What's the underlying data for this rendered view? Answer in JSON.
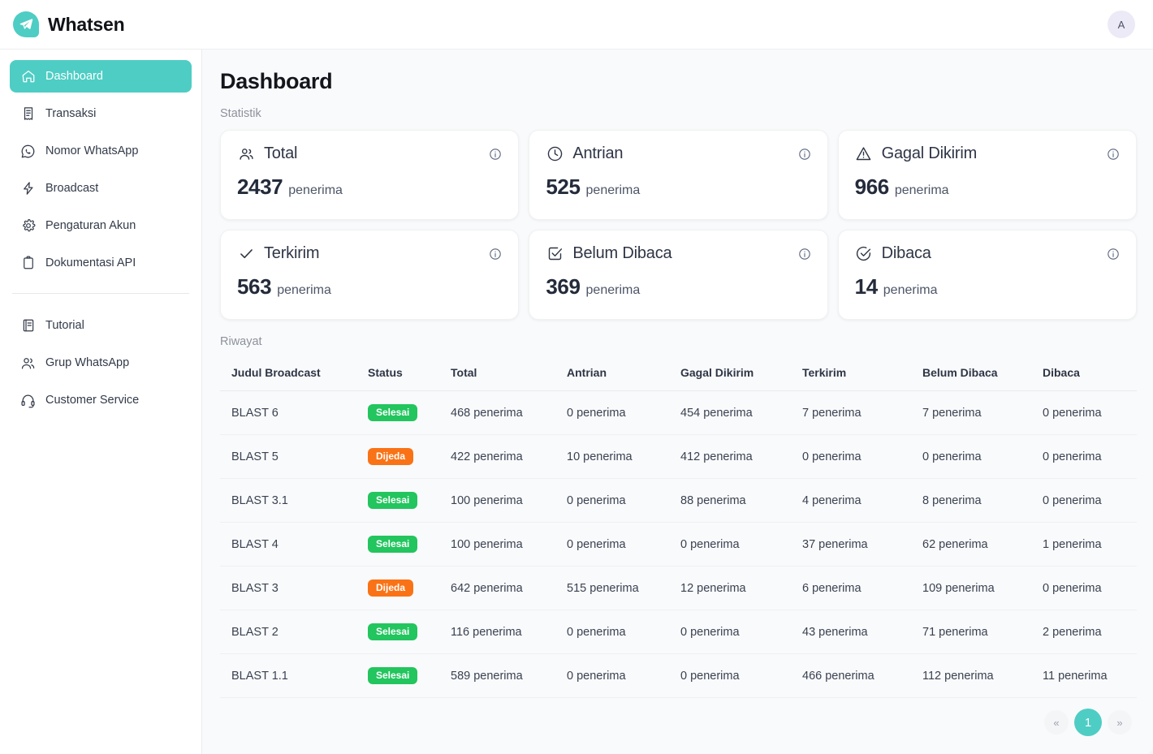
{
  "app": {
    "brand_name": "Whatsen",
    "logo_icon": "paper-plane-chat-icon",
    "avatar_initial": "A",
    "accent_color": "#4ecdc4",
    "success_color": "#22c55e",
    "warning_color": "#f97316"
  },
  "sidebar": {
    "primary_items": [
      {
        "label": "Dashboard",
        "icon": "home-icon",
        "active": true
      },
      {
        "label": "Transaksi",
        "icon": "receipt-icon",
        "active": false
      },
      {
        "label": "Nomor WhatsApp",
        "icon": "whatsapp-icon",
        "active": false
      },
      {
        "label": "Broadcast",
        "icon": "bolt-icon",
        "active": false
      },
      {
        "label": "Pengaturan Akun",
        "icon": "gear-icon",
        "active": false
      },
      {
        "label": "Dokumentasi API",
        "icon": "clipboard-icon",
        "active": false
      }
    ],
    "secondary_items": [
      {
        "label": "Tutorial",
        "icon": "book-icon"
      },
      {
        "label": "Grup WhatsApp",
        "icon": "users-icon"
      },
      {
        "label": "Customer Service",
        "icon": "headset-icon"
      }
    ]
  },
  "main": {
    "page_title": "Dashboard",
    "stats_label": "Statistik",
    "history_label": "Riwayat",
    "stats": [
      {
        "label": "Total",
        "icon": "users-icon",
        "value": "2437",
        "unit": "penerima",
        "info_icon": "info-circle-icon"
      },
      {
        "label": "Antrian",
        "icon": "clock-icon",
        "value": "525",
        "unit": "penerima",
        "info_icon": "info-circle-icon"
      },
      {
        "label": "Gagal Dikirim",
        "icon": "warning-icon",
        "value": "966",
        "unit": "penerima",
        "info_icon": "info-circle-icon"
      },
      {
        "label": "Terkirim",
        "icon": "check-icon",
        "value": "563",
        "unit": "penerima",
        "info_icon": "info-circle-icon"
      },
      {
        "label": "Belum Dibaca",
        "icon": "check-square-icon",
        "value": "369",
        "unit": "penerima",
        "info_icon": "info-circle-icon"
      },
      {
        "label": "Dibaca",
        "icon": "check-circle-icon",
        "value": "14",
        "unit": "penerima",
        "info_icon": "info-circle-icon"
      }
    ],
    "table": {
      "columns": [
        "Judul Broadcast",
        "Status",
        "Total",
        "Antrian",
        "Gagal Dikirim",
        "Terkirim",
        "Belum Dibaca",
        "Dibaca"
      ],
      "rows": [
        {
          "judul": "BLAST 6",
          "status": "Selesai",
          "status_kind": "selesai",
          "total": "468 penerima",
          "antrian": "0 penerima",
          "gagal": "454 penerima",
          "terkirim": "7 penerima",
          "belum": "7 penerima",
          "dibaca": "0 penerima"
        },
        {
          "judul": "BLAST 5",
          "status": "Dijeda",
          "status_kind": "dijeda",
          "total": "422 penerima",
          "antrian": "10 penerima",
          "gagal": "412 penerima",
          "terkirim": "0 penerima",
          "belum": "0 penerima",
          "dibaca": "0 penerima"
        },
        {
          "judul": "BLAST 3.1",
          "status": "Selesai",
          "status_kind": "selesai",
          "total": "100 penerima",
          "antrian": "0 penerima",
          "gagal": "88 penerima",
          "terkirim": "4 penerima",
          "belum": "8 penerima",
          "dibaca": "0 penerima"
        },
        {
          "judul": "BLAST 4",
          "status": "Selesai",
          "status_kind": "selesai",
          "total": "100 penerima",
          "antrian": "0 penerima",
          "gagal": "0 penerima",
          "terkirim": "37 penerima",
          "belum": "62 penerima",
          "dibaca": "1 penerima"
        },
        {
          "judul": "BLAST 3",
          "status": "Dijeda",
          "status_kind": "dijeda",
          "total": "642 penerima",
          "antrian": "515 penerima",
          "gagal": "12 penerima",
          "terkirim": "6 penerima",
          "belum": "109 penerima",
          "dibaca": "0 penerima"
        },
        {
          "judul": "BLAST 2",
          "status": "Selesai",
          "status_kind": "selesai",
          "total": "116 penerima",
          "antrian": "0 penerima",
          "gagal": "0 penerima",
          "terkirim": "43 penerima",
          "belum": "71 penerima",
          "dibaca": "2 penerima"
        },
        {
          "judul": "BLAST 1.1",
          "status": "Selesai",
          "status_kind": "selesai",
          "total": "589 penerima",
          "antrian": "0 penerima",
          "gagal": "0 penerima",
          "terkirim": "466 penerima",
          "belum": "112 penerima",
          "dibaca": "11 penerima"
        }
      ]
    },
    "pagination": {
      "prev": "«",
      "next": "»",
      "current_page": "1"
    }
  }
}
